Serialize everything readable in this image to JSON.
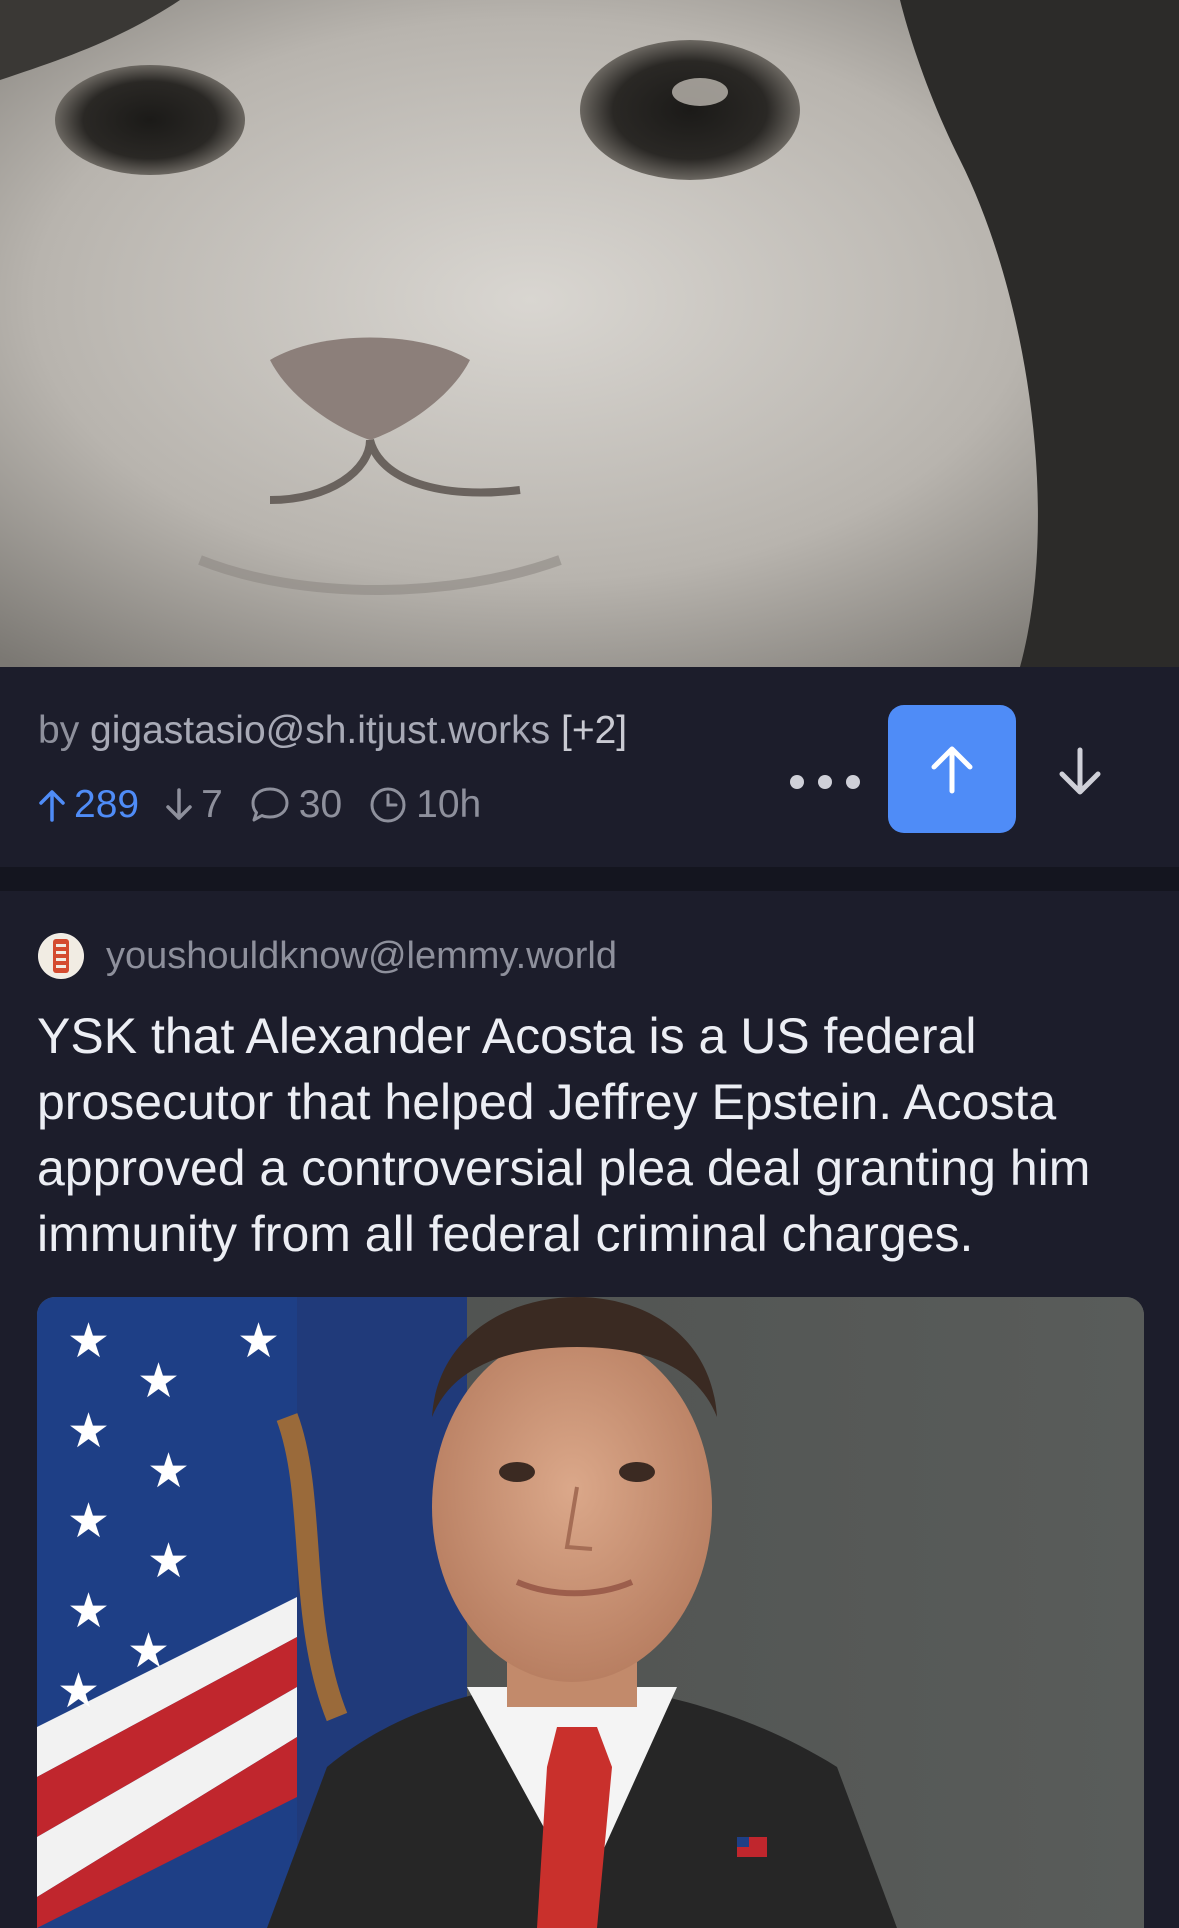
{
  "post1": {
    "image_alt": "cat face close-up",
    "byline_prefix": "by ",
    "author": "gigastasio@sh.itjust.works",
    "extra": "[+2]",
    "upvotes": "289",
    "downvotes": "7",
    "comments": "30",
    "age": "10h",
    "icons": [
      "arrow-up-icon",
      "arrow-down-icon",
      "comment-bubble-icon",
      "clock-icon",
      "more-dots-icon"
    ],
    "upvote_color": "#4f8cf7"
  },
  "post2": {
    "community": "youshouldknow@lemmy.world",
    "title": "YSK that Alexander Acosta is a US federal prosecutor that helped Jeffrey Epstein. Acosta approved a controversial plea deal granting him immunity from all federal criminal charges.",
    "image_alt": "portrait of man in suit in front of US flag"
  },
  "colors": {
    "background": "#1c1d2b",
    "accent": "#4f8cf7",
    "muted_text": "#8e909c",
    "title_text": "#eceef4"
  }
}
